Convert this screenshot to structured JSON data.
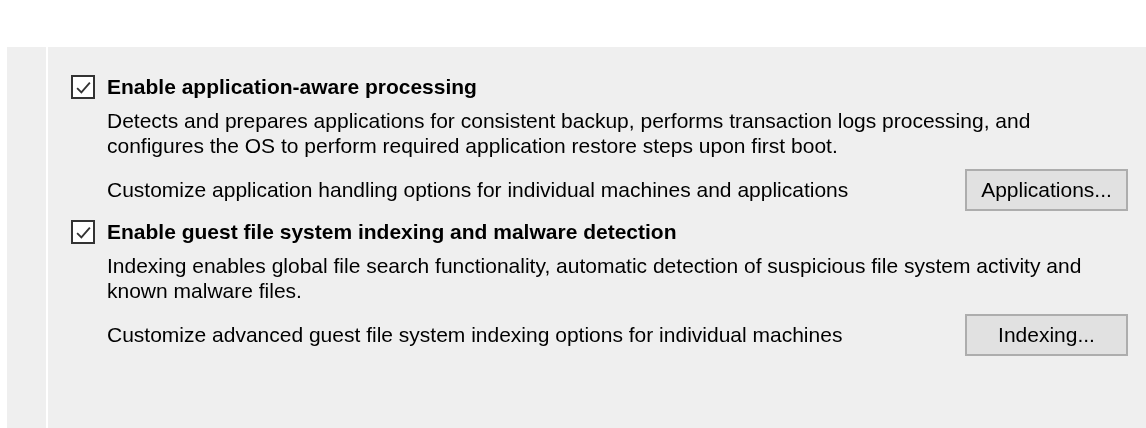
{
  "options": [
    {
      "label": "Enable application-aware processing",
      "checked": true,
      "description": "Detects and prepares applications for consistent backup, performs transaction logs processing, and configures the OS to perform required application restore steps upon first boot.",
      "customize": "Customize application handling options for individual machines and applications",
      "button": "Applications..."
    },
    {
      "label": "Enable guest file system indexing and malware detection",
      "checked": true,
      "description": "Indexing enables global file search functionality, automatic detection of suspicious file system activity and known malware files.",
      "customize": "Customize advanced guest file system indexing options for individual machines",
      "button": "Indexing..."
    }
  ]
}
